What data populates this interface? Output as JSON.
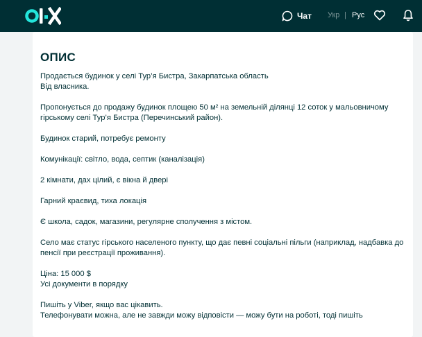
{
  "header": {
    "chat_label": "Чат",
    "lang_ukr": "Укр",
    "lang_separator": "|",
    "lang_rus": "Рус",
    "brand_color": "#002f34",
    "logo_colors": [
      "#23e5db",
      "#ffffff"
    ],
    "icons": [
      "olx-logo",
      "chat-icon",
      "heart-icon",
      "bell-icon"
    ]
  },
  "description": {
    "title": "ОПИС",
    "line1": "Продається будинок у селі Тур’я Бистра, Закарпатська область",
    "line2": "Від власника.",
    "line3": "Пропонується до продажу будинок площею 50 м² на земельній ділянці 12 соток у мальовничому",
    "line4": "гірському селі Тур’я Бистра (Перечинський район).",
    "line5": "Будинок старий, потребує ремонту",
    "line6": "Комунікації: світло, вода, септик (каналізація)",
    "line7": "2 кімнати, дах цілий, є вікна й двері",
    "line8": "Гарний краєвид, тиха локація",
    "line9": "Є школа, садок, магазини, регулярне сполучення з містом.",
    "line10": "Село має статус гірського населеного пункту, що дає певні соціальні пільги (наприклад, надбавка до",
    "line11": "пенсії при реєстрації проживання).",
    "line12": "Ціна: 15 000 $",
    "line13": "Усі документи в порядку",
    "line14": "Пишіть у Viber, якщо вас цікавить.",
    "line15": "Телефонувати можна, але не завжди можу відповісти — можу бути на роботі, тоді пишіть"
  }
}
